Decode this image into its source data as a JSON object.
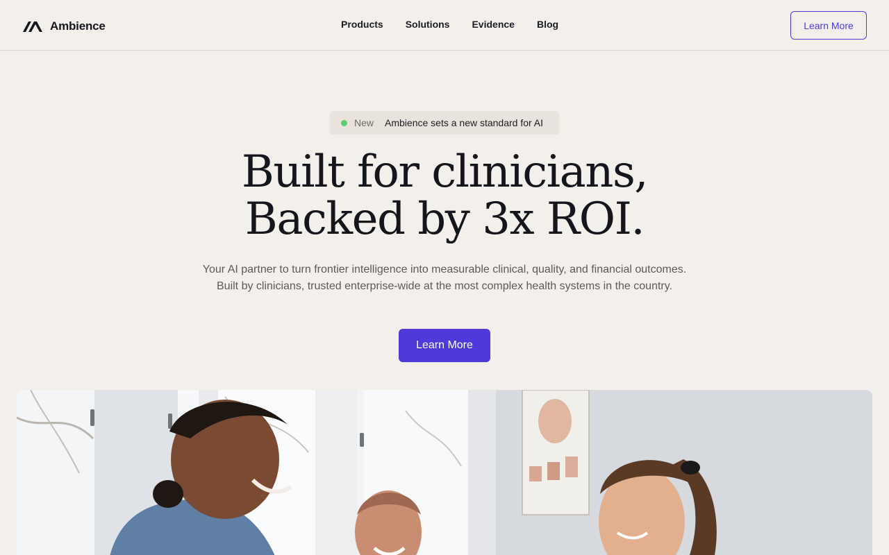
{
  "brand": {
    "name": "Ambience",
    "accent": "#4f3ad9",
    "background": "#f3f0eb"
  },
  "nav": {
    "items": [
      {
        "label": "Products"
      },
      {
        "label": "Solutions"
      },
      {
        "label": "Evidence"
      },
      {
        "label": "Blog"
      }
    ],
    "cta_label": "Learn More"
  },
  "announcement": {
    "tag": "New",
    "text": "Ambience sets a new standard for AI",
    "dot_color": "#5ccf6a"
  },
  "hero": {
    "title_line1": "Built for clinicians,",
    "title_line2": "Backed by 3x ROI.",
    "subtitle": "Your AI partner to turn frontier intelligence into measurable clinical, quality, and financial outcomes. Built by clinicians, trusted enterprise-wide at the most complex health systems in the country.",
    "cta_label": "Learn More"
  },
  "hero_image": {
    "icon": "clinic-photo-illustration"
  }
}
